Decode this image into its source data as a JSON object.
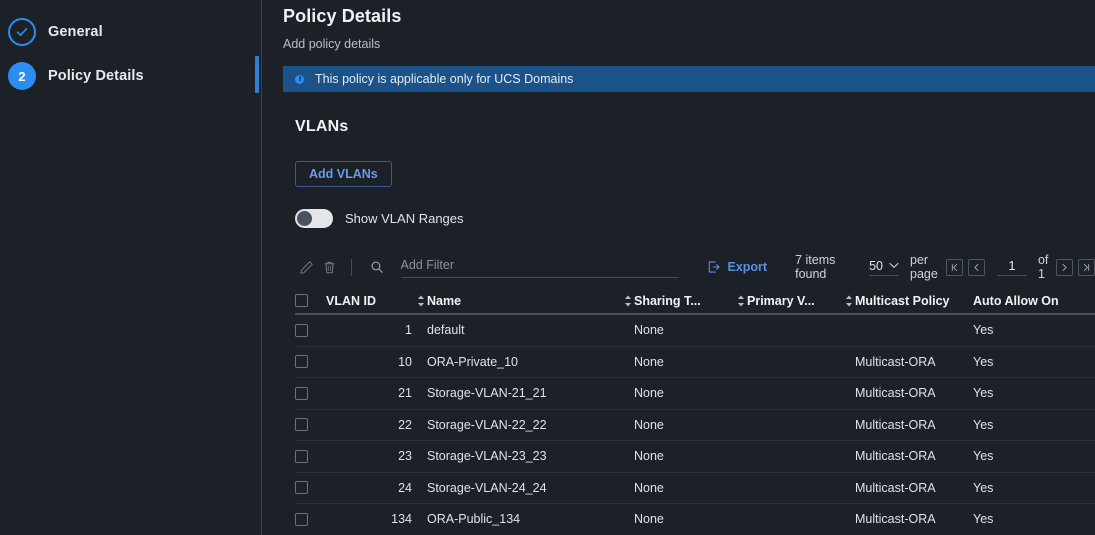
{
  "colors": {
    "background": "#1c2128",
    "accent": "#2d8cf0",
    "banner_bg": "#1b5288",
    "link": "#5b8fe0",
    "text": "#dfe3e8"
  },
  "sidebar": {
    "steps": [
      {
        "label": "General",
        "marker": "check-icon",
        "state": "completed"
      },
      {
        "label": "Policy Details",
        "marker": "2",
        "state": "active"
      }
    ]
  },
  "header": {
    "title": "Policy Details",
    "subtitle": "Add policy details",
    "banner": {
      "icon": "info-icon",
      "text": "This policy is applicable only for UCS Domains"
    }
  },
  "section": {
    "title": "VLANs",
    "add_button": "Add VLANs",
    "toggle": {
      "label": "Show VLAN Ranges",
      "state": "off"
    }
  },
  "toolbar": {
    "edit_icon": "pencil-icon",
    "delete_icon": "trash-icon",
    "search_icon": "search-icon",
    "filter_placeholder": "Add Filter",
    "filter_value": "",
    "export_label": "Export",
    "export_icon": "export-icon",
    "items_found": "7 items found",
    "per_page_value": "50",
    "per_page_label": "per page",
    "page_value": "1",
    "page_of": "of 1",
    "pagination": {
      "first": "⏮",
      "prev": "❮",
      "next": "❯",
      "last": "⏭"
    }
  },
  "table": {
    "columns": [
      {
        "label": "VLAN ID",
        "sortable": true
      },
      {
        "label": "Name",
        "sortable": true
      },
      {
        "label": "Sharing T...",
        "sortable": true
      },
      {
        "label": "Primary V...",
        "sortable": true
      },
      {
        "label": "Multicast Policy",
        "sortable": false
      },
      {
        "label": "Auto Allow On",
        "sortable": false
      }
    ],
    "rows": [
      {
        "vlan_id": "1",
        "name": "default",
        "sharing": "None",
        "primary": "",
        "multicast": "",
        "auto_allow": "Yes"
      },
      {
        "vlan_id": "10",
        "name": "ORA-Private_10",
        "sharing": "None",
        "primary": "",
        "multicast": "Multicast-ORA",
        "auto_allow": "Yes"
      },
      {
        "vlan_id": "21",
        "name": "Storage-VLAN-21_21",
        "sharing": "None",
        "primary": "",
        "multicast": "Multicast-ORA",
        "auto_allow": "Yes"
      },
      {
        "vlan_id": "22",
        "name": "Storage-VLAN-22_22",
        "sharing": "None",
        "primary": "",
        "multicast": "Multicast-ORA",
        "auto_allow": "Yes"
      },
      {
        "vlan_id": "23",
        "name": "Storage-VLAN-23_23",
        "sharing": "None",
        "primary": "",
        "multicast": "Multicast-ORA",
        "auto_allow": "Yes"
      },
      {
        "vlan_id": "24",
        "name": "Storage-VLAN-24_24",
        "sharing": "None",
        "primary": "",
        "multicast": "Multicast-ORA",
        "auto_allow": "Yes"
      },
      {
        "vlan_id": "134",
        "name": "ORA-Public_134",
        "sharing": "None",
        "primary": "",
        "multicast": "Multicast-ORA",
        "auto_allow": "Yes"
      }
    ]
  }
}
